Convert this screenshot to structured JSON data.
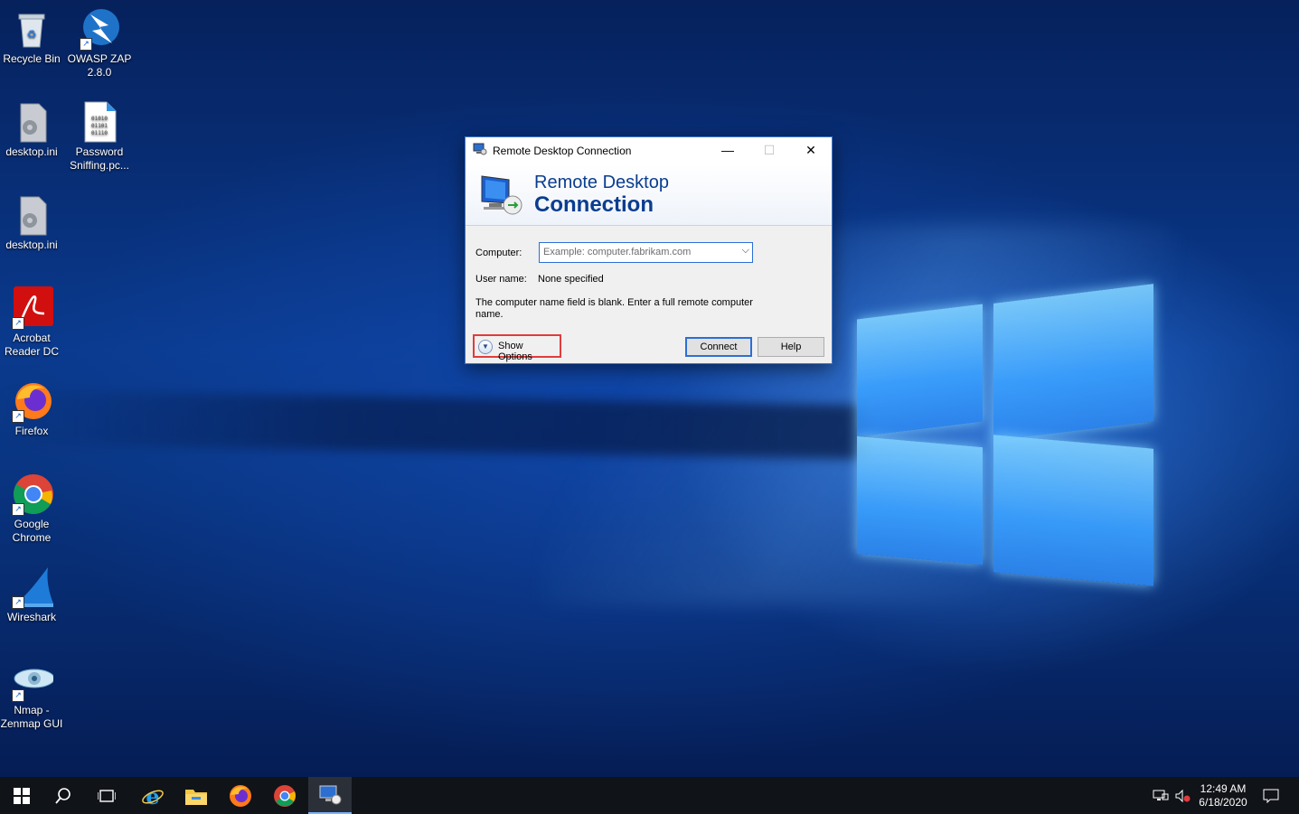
{
  "desktop": {
    "icons": [
      {
        "label": "Recycle Bin"
      },
      {
        "label": "OWASP ZAP 2.8.0"
      },
      {
        "label": "desktop.ini"
      },
      {
        "label": "Password Sniffing.pc..."
      },
      {
        "label": "desktop.ini"
      },
      {
        "label": "Acrobat Reader DC"
      },
      {
        "label": "Firefox"
      },
      {
        "label": "Google Chrome"
      },
      {
        "label": "Wireshark"
      },
      {
        "label": "Nmap - Zenmap GUI"
      }
    ]
  },
  "dialog": {
    "title": "Remote Desktop Connection",
    "banner_line1": "Remote Desktop",
    "banner_line2": "Connection",
    "computer_label": "Computer:",
    "computer_placeholder": "Example: computer.fabrikam.com",
    "username_label": "User name:",
    "username_value": "None specified",
    "message": "The computer name field is blank. Enter a full remote computer name.",
    "show_options": "Show Options",
    "connect": "Connect",
    "help": "Help",
    "minimize_glyph": "—",
    "maximize_glyph": "☐",
    "close_glyph": "✕"
  },
  "taskbar": {
    "start_glyph": "⊞",
    "search_glyph": "⚲",
    "taskview_glyph": "⧉",
    "time": "12:49 AM",
    "date": "6/18/2020",
    "notification_glyph": "▭"
  },
  "colors": {
    "accent": "#3e78c8",
    "highlight": "#e03c3c",
    "taskbar": "#101318"
  }
}
